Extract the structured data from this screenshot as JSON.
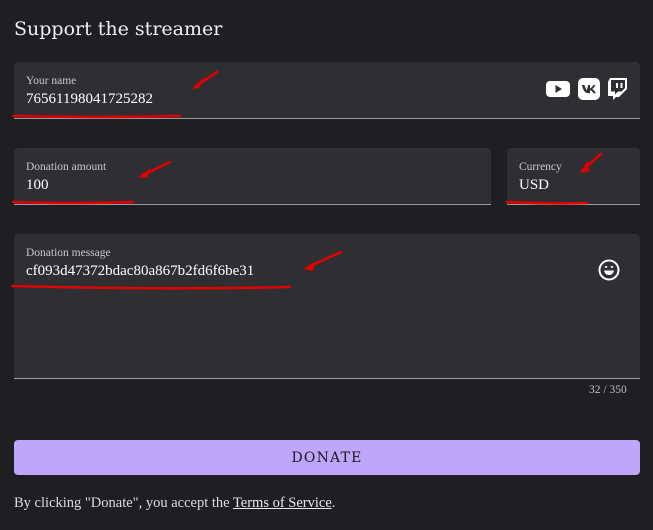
{
  "header": {
    "title": "Support the streamer"
  },
  "name_field": {
    "label": "Your name",
    "value": "76561198041725282"
  },
  "socials": {
    "youtube": "youtube-icon",
    "vk": "vk-icon",
    "twitch": "twitch-icon"
  },
  "amount_field": {
    "label": "Donation amount",
    "value": "100"
  },
  "currency_field": {
    "label": "Currency",
    "value": "USD"
  },
  "message_field": {
    "label": "Donation message",
    "value": "cf093d47372bdac80a867b2fd6f6be31",
    "emoji_icon": "emoji-smile-icon"
  },
  "counter": {
    "text": "32 / 350"
  },
  "donate_button": {
    "label": "DONATE"
  },
  "terms": {
    "prefix": "By clicking \"Donate\", you accept the ",
    "link": "Terms of Service",
    "suffix": "."
  },
  "colors": {
    "background": "#1f1f23",
    "field": "#2f2f33",
    "accent": "#bfa6fb",
    "annotation": "#e00000"
  }
}
